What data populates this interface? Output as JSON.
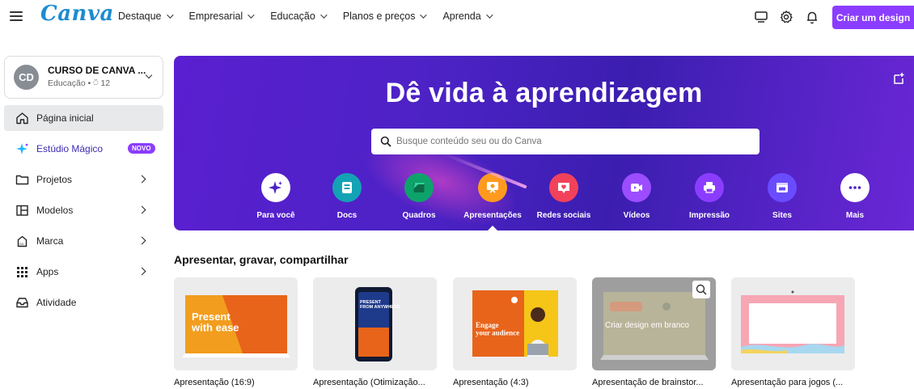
{
  "topnav": {
    "logo": "Canva",
    "menu": [
      {
        "label": "Destaque"
      },
      {
        "label": "Empresarial"
      },
      {
        "label": "Educação"
      },
      {
        "label": "Planos e preços"
      },
      {
        "label": "Aprenda"
      }
    ],
    "icons": [
      "monitor-icon",
      "gear-icon",
      "bell-icon"
    ],
    "create_button": "Criar um design"
  },
  "sidebar": {
    "team": {
      "initials": "CD",
      "name": "CURSO DE CANVA ...",
      "subtitle": "Educação • ⍥ 12"
    },
    "items": [
      {
        "label": "Página inicial",
        "icon": "home-icon",
        "active": true
      },
      {
        "label": "Estúdio Mágico",
        "icon": "magic-sparkle-icon",
        "badge": "NOVO"
      },
      {
        "label": "Projetos",
        "icon": "folder-icon"
      },
      {
        "label": "Modelos",
        "icon": "template-icon"
      },
      {
        "label": "Marca",
        "icon": "brand-icon"
      },
      {
        "label": "Apps",
        "icon": "apps-grid-icon"
      },
      {
        "label": "Atividade",
        "icon": "inbox-icon"
      }
    ]
  },
  "hero": {
    "title": "Dê vida à aprendizagem",
    "search_placeholder": "Busque conteúdo seu ou do Canva",
    "categories": [
      {
        "label": "Para você",
        "color": "#ffffff",
        "icon": "sparkle-icon"
      },
      {
        "label": "Docs",
        "color": "#13a3b5",
        "icon": "doc-icon"
      },
      {
        "label": "Quadros",
        "color": "#0ea36b",
        "icon": "whiteboard-icon"
      },
      {
        "label": "Apresentações",
        "color": "#ff9a1f",
        "icon": "presentation-icon"
      },
      {
        "label": "Redes sociais",
        "color": "#f2425b",
        "icon": "heart-chat-icon"
      },
      {
        "label": "Vídeos",
        "color": "#9b4dff",
        "icon": "video-icon"
      },
      {
        "label": "Impressão",
        "color": "#8b3dff",
        "icon": "printer-icon"
      },
      {
        "label": "Sites",
        "color": "#6a4cff",
        "icon": "website-icon"
      },
      {
        "label": "Mais",
        "color": "#ffffff",
        "icon": "more-icon"
      }
    ]
  },
  "section": {
    "title": "Apresentar, gravar, compartilhar",
    "cards": [
      {
        "label": "Apresentação (16:9)",
        "thumb_text": "Present with ease"
      },
      {
        "label": "Apresentação (Otimização...",
        "thumb_text": "PRESENT FROM ANYWHERE"
      },
      {
        "label": "Apresentação (4:3)",
        "thumb_text": "Engage your audience"
      },
      {
        "label": "Apresentação de brainstor...",
        "thumb_text": "Criar design em branco"
      },
      {
        "label": "Apresentação para jogos (...",
        "thumb_text": ""
      }
    ]
  }
}
